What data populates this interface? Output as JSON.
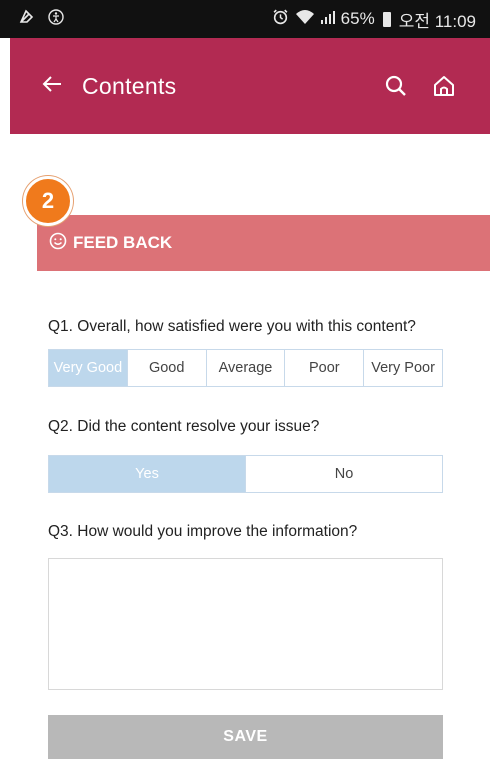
{
  "status_bar": {
    "left_icons": [
      "dropbox-icon",
      "accessibility-icon"
    ],
    "right_icons": [
      "alarm-icon",
      "wifi-icon",
      "signal-icon",
      "battery-icon"
    ],
    "battery": "65%",
    "time": "오전 11:09"
  },
  "app_bar": {
    "title": "Contents",
    "color": "#b22a52"
  },
  "step_badge": "2",
  "section": {
    "title": "FEED BACK",
    "icon": "smiley-icon",
    "color": "#dc7277"
  },
  "q1": {
    "text": "Q1. Overall, how satisfied were you with this content?",
    "options": [
      "Very Good",
      "Good",
      "Average",
      "Poor",
      "Very Poor"
    ],
    "selected": "Very Good"
  },
  "q2": {
    "text": "Q2. Did the content resolve your issue?",
    "options": [
      "Yes",
      "No"
    ],
    "selected": "Yes"
  },
  "q3": {
    "text": "Q3. How would you improve the information?",
    "value": "",
    "placeholder": ""
  },
  "save_label": "SAVE",
  "colors": {
    "selected": "#bdd7ec",
    "save_disabled": "#b8b8b8"
  }
}
